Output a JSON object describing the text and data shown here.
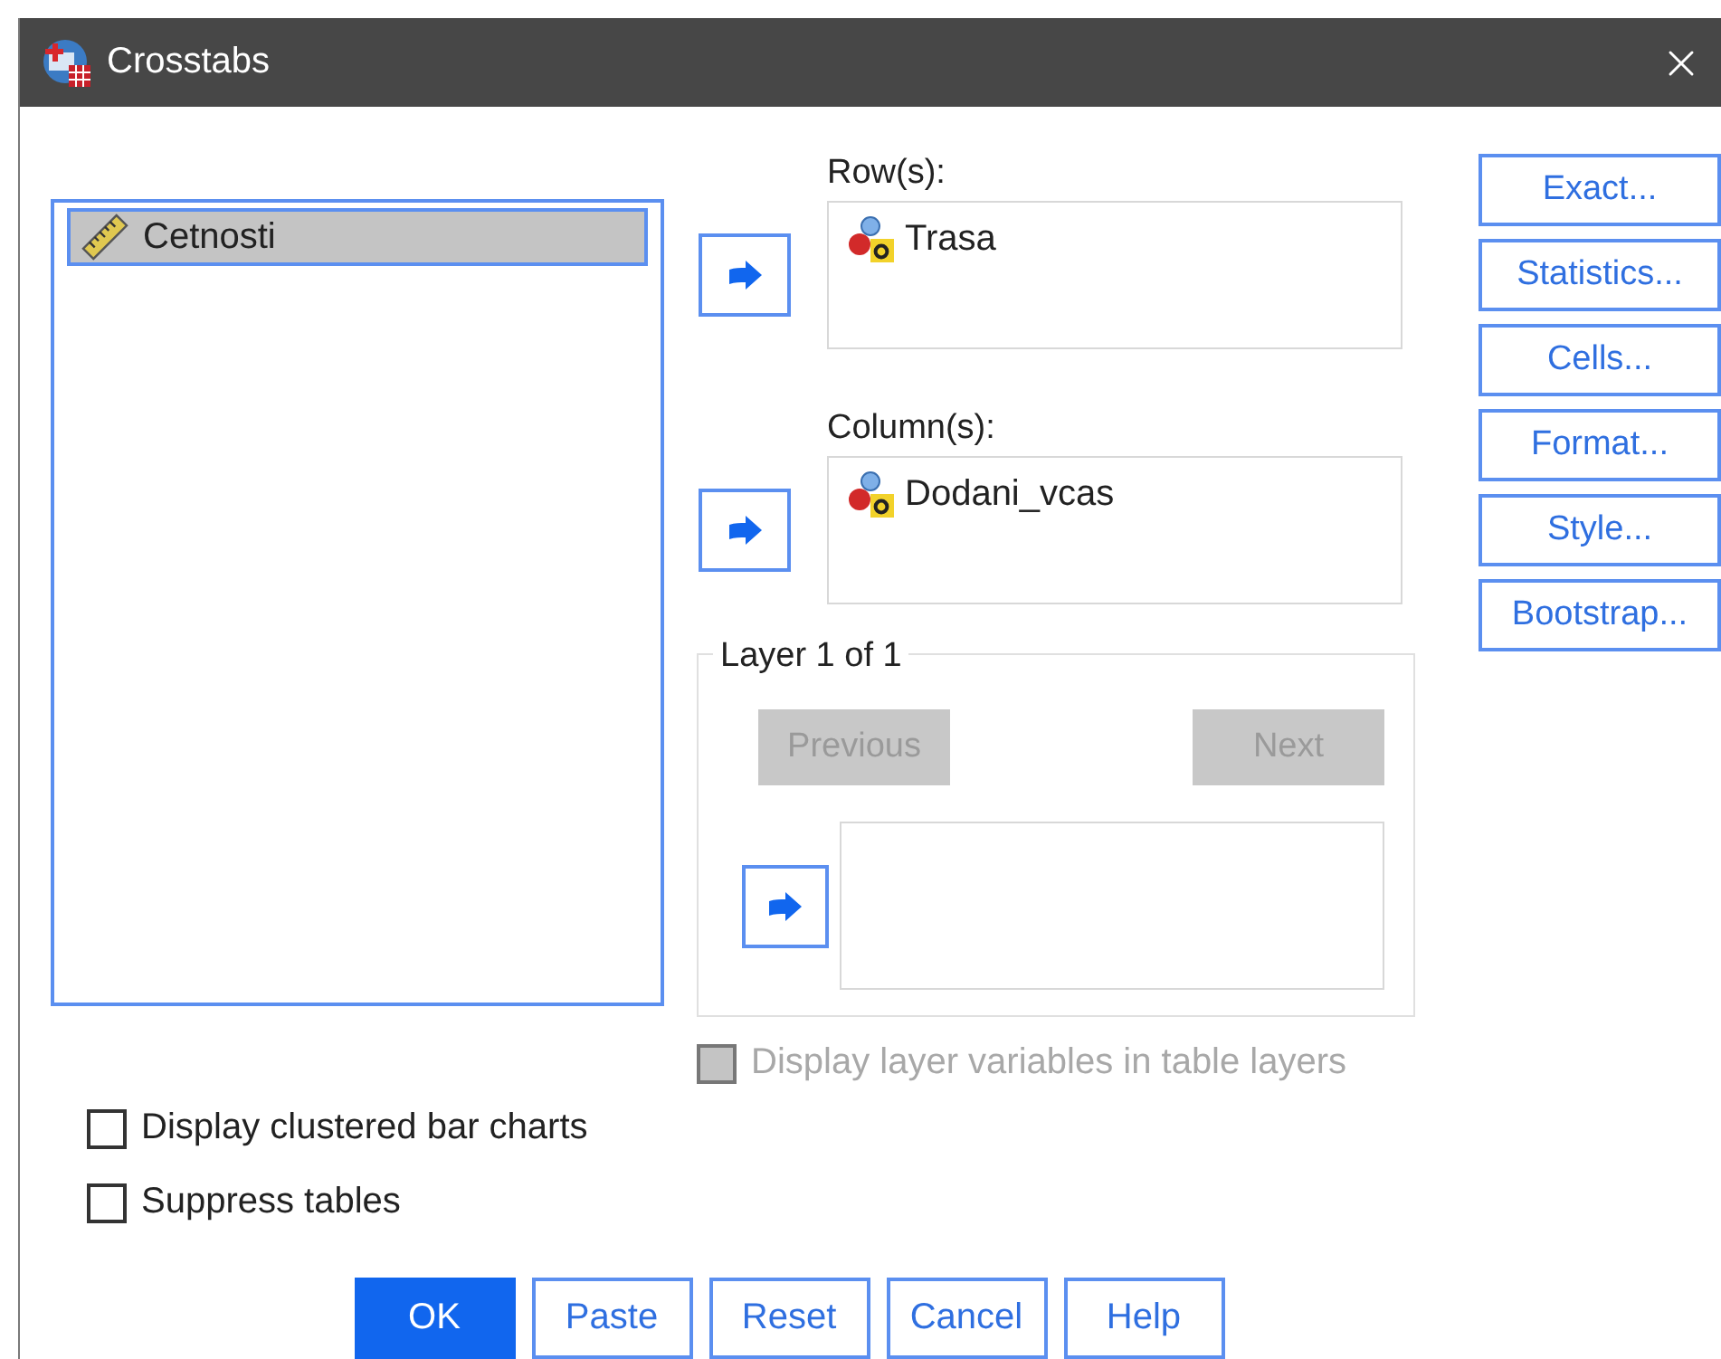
{
  "window": {
    "title": "Crosstabs"
  },
  "source_list": {
    "items": [
      {
        "name": "Cetnosti",
        "kind": "scale",
        "selected": true
      }
    ]
  },
  "rows": {
    "label": "Row(s):",
    "items": [
      {
        "name": "Trasa",
        "kind": "nominal"
      }
    ]
  },
  "columns": {
    "label": "Column(s):",
    "items": [
      {
        "name": "Dodani_vcas",
        "kind": "nominal"
      }
    ]
  },
  "layer": {
    "title": "Layer 1 of 1",
    "previous": {
      "label": "Previous",
      "disabled": true
    },
    "next": {
      "label": "Next",
      "disabled": true
    }
  },
  "layer_option": {
    "label": "Display layer variables in table layers",
    "checked": false,
    "disabled": true
  },
  "side_buttons": [
    {
      "label": "Exact..."
    },
    {
      "label": "Statistics..."
    },
    {
      "label": "Cells..."
    },
    {
      "label": "Format..."
    },
    {
      "label": "Style..."
    },
    {
      "label": "Bootstrap..."
    }
  ],
  "options": [
    {
      "label": "Display clustered bar charts",
      "checked": false
    },
    {
      "label": "Suppress tables",
      "checked": false
    }
  ],
  "buttons": [
    {
      "label": "OK",
      "default": true
    },
    {
      "label": "Paste",
      "default": false
    },
    {
      "label": "Reset",
      "default": false
    },
    {
      "label": "Cancel",
      "default": false
    },
    {
      "label": "Help",
      "default": false
    }
  ]
}
